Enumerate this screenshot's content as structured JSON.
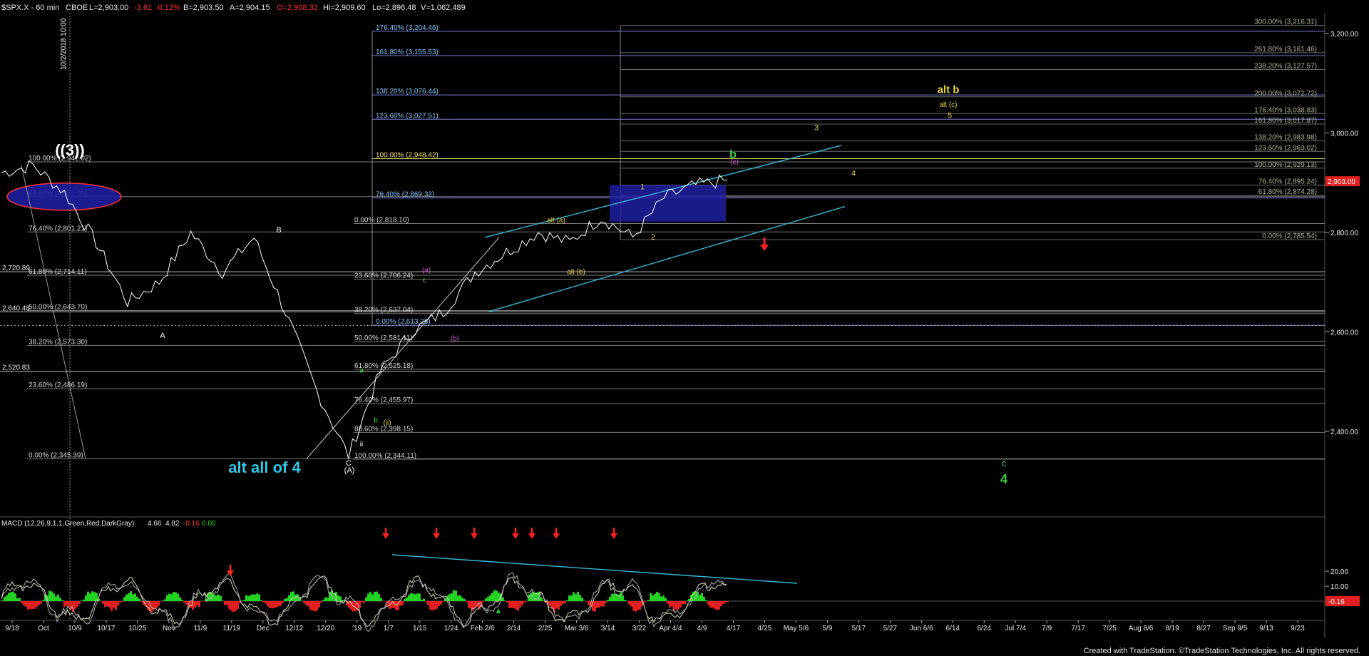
{
  "header": {
    "symbol": "$SPX.X - 60 min",
    "exchange": "CBOE",
    "last": "L=2,903.00",
    "change": "-3.61",
    "change_pct": "-0.12%",
    "bid": "B=2,903.50",
    "ask": "A=2,904.15",
    "open": "O=2,908.32",
    "high": "Hi=2,909.60",
    "low": "Lo=2,896.48",
    "volume": "V=1,062,489"
  },
  "vertical_date_label": "10/2/2018 10:00",
  "price_axis": {
    "ticks": [
      {
        "label": "3,200.00",
        "value": 3200
      },
      {
        "label": "3,000.00",
        "value": 3000
      },
      {
        "label": "2,800.00",
        "value": 2800
      },
      {
        "label": "2,600.00",
        "value": 2600
      },
      {
        "label": "2,400.00",
        "value": 2400
      }
    ],
    "last_price_tag": "2,903.00"
  },
  "time_axis": [
    "9/18",
    "Oct",
    "10/9",
    "10/17",
    "10/25",
    "Nov",
    "11/9",
    "11/19",
    "Dec",
    "12/12",
    "12/20",
    "'19",
    "1/7",
    "1/15",
    "1/24",
    "Feb 2/6",
    "2/14",
    "2/25",
    "Mar 3/6",
    "3/14",
    "3/22",
    "Apr 4/4",
    "4/9",
    "4/17",
    "4/25",
    "May 5/6",
    "5/9",
    "5/17",
    "5/27",
    "Jun 6/6",
    "6/14",
    "6/24",
    "Jul 7/4",
    "7/9",
    "7/17",
    "7/25",
    "Aug 8/6",
    "8/19",
    "8/27",
    "Sep 9/5",
    "9/13",
    "9/23"
  ],
  "fib_labels": {
    "left": [
      {
        "text": "100.00% (2,942.02)",
        "value": 2942
      },
      {
        "text": "88.60% (2,871.95)",
        "value": 2872
      },
      {
        "text": "76.40% (2,801.21)",
        "value": 2801
      },
      {
        "text": "61.80% (2,714.11)",
        "value": 2714
      },
      {
        "text": "50.00% (2,643.70)",
        "value": 2643
      },
      {
        "text": "38.20% (2,573.30)",
        "value": 2573
      },
      {
        "text": "23.60% (2,486.19)",
        "value": 2486
      },
      {
        "text": "0.00% (2,345.39)",
        "value": 2345
      }
    ],
    "left_edge": [
      {
        "text": "2,720.89",
        "value": 2720.89
      },
      {
        "text": "2,640.48",
        "value": 2640.48
      },
      {
        "text": "2,520.83",
        "value": 2520.83
      }
    ],
    "middle_cyan": [
      {
        "text": "176.40% (3,204.46)",
        "value": 3204.46
      },
      {
        "text": "161.80% (3,155.53)",
        "value": 3155.53
      },
      {
        "text": "138.20% (3,076.44)",
        "value": 3076.44
      },
      {
        "text": "123.60% (3,027.51)",
        "value": 3027.51
      },
      {
        "text": "100.00% (2,948.42)",
        "value": 2948.42
      },
      {
        "text": "76.40% (2,869.32)",
        "value": 2869.32
      },
      {
        "text": "0.00% (2,613.28)",
        "value": 2613.28
      }
    ],
    "middle_white": [
      {
        "text": "0.00% (2,818.10)",
        "value": 2818
      },
      {
        "text": "23.60% (2,706.24)",
        "value": 2706
      },
      {
        "text": "38.20% (2,637.04)",
        "value": 2637
      },
      {
        "text": "50.00% (2,581.11)",
        "value": 2581
      },
      {
        "text": "61.80% (2,525.18)",
        "value": 2525
      },
      {
        "text": "76.40% (2,455.97)",
        "value": 2456
      },
      {
        "text": "88.60% (2,398.15)",
        "value": 2398
      },
      {
        "text": "100.00% (2,344.11)",
        "value": 2344
      }
    ],
    "right": [
      {
        "text": "300.00% (3,216.31)",
        "value": 3216.31
      },
      {
        "text": "261.80% (3,161.46)",
        "value": 3161.46
      },
      {
        "text": "238.20% (3,127.57)",
        "value": 3127.57
      },
      {
        "text": "200.00% (3,072.72)",
        "value": 3072.72
      },
      {
        "text": "176.40% (3,038.83)",
        "value": 3038.83
      },
      {
        "text": "161.80% (3,017.87)",
        "value": 3017.87
      },
      {
        "text": "138.20% (2,983.98)",
        "value": 2983.98
      },
      {
        "text": "123.60% (2,963.02)",
        "value": 2963.02
      },
      {
        "text": "100.00% (2,929.13)",
        "value": 2929.13
      },
      {
        "text": "76.40% (2,895.24)",
        "value": 2895.24
      },
      {
        "text": "61.80% (2,874.28)",
        "value": 2874.28
      },
      {
        "text": "0.00% (2,785.54)",
        "value": 2785.54
      }
    ]
  },
  "wave_labels": [
    {
      "text": "((3))",
      "color": "#ffffff"
    },
    {
      "text": "A",
      "color": "#ffffff"
    },
    {
      "text": "B",
      "color": "#ffffff"
    },
    {
      "text": "C",
      "color": "#ffffff"
    },
    {
      "text": "(A)",
      "color": "#ffffff"
    },
    {
      "text": "alt all of 4",
      "color": "#33c5e6"
    },
    {
      "text": "ii",
      "color": "#ffffff"
    },
    {
      "text": "(ii)",
      "color": "#e8d33a"
    },
    {
      "text": "a",
      "color": "#3fd13f"
    },
    {
      "text": "b",
      "color": "#3fd13f"
    },
    {
      "text": "c",
      "color": "#3fd13f"
    },
    {
      "text": "(a)",
      "color": "#d04fd0"
    },
    {
      "text": "(b)",
      "color": "#d04fd0"
    },
    {
      "text": "alt (a)",
      "color": "#e8d33a"
    },
    {
      "text": "alt (b)",
      "color": "#e8d33a"
    },
    {
      "text": "1",
      "color": "#e8d33a"
    },
    {
      "text": "2",
      "color": "#e8d33a"
    },
    {
      "text": "3",
      "color": "#e8d33a"
    },
    {
      "text": "4",
      "color": "#e8d33a"
    },
    {
      "text": "5",
      "color": "#e8d33a"
    },
    {
      "text": "b",
      "color": "#3fd13f"
    },
    {
      "text": "(c)",
      "color": "#d04fd0"
    },
    {
      "text": "alt b",
      "color": "#e8d33a"
    },
    {
      "text": "alt (c)",
      "color": "#e8d33a"
    },
    {
      "text": "c",
      "color": "#3fd13f"
    },
    {
      "text": "4",
      "color": "#3fd13f"
    }
  ],
  "macd": {
    "title": "MACD (12,26,9,1,1,Green,Red,DarkGray)",
    "v1": "4.66",
    "v2": "4.82",
    "v3": "-0.16",
    "v4": "0.00",
    "ticks": [
      {
        "label": "20.00",
        "value": 20
      },
      {
        "label": "10.00",
        "value": 10
      }
    ],
    "tag": "-0.16"
  },
  "footer": "Created with TradeStation. ©TradeStation Technologies, Inc. All rights reserved.",
  "chart_data": {
    "type": "line",
    "title": "$SPX.X - 60 min",
    "xlabel": "",
    "ylabel": "",
    "ylim": [
      2310,
      3250
    ],
    "x_categories": [
      "9/18",
      "Oct",
      "10/9",
      "10/17",
      "10/25",
      "Nov",
      "11/9",
      "11/19",
      "Dec",
      "12/12",
      "12/20",
      "'19",
      "1/7",
      "1/15",
      "1/24",
      "Feb 2/6",
      "2/14",
      "2/25",
      "Mar 3/6",
      "3/14",
      "3/22",
      "Apr 4/4",
      "4/9",
      "4/17"
    ],
    "series": [
      {
        "values": [
          2920,
          2935,
          2880,
          2780,
          2660,
          2700,
          2800,
          2720,
          2790,
          2640,
          2480,
          2351,
          2520,
          2600,
          2640,
          2720,
          2760,
          2800,
          2780,
          2830,
          2790,
          2870,
          2895,
          2905
        ]
      }
    ],
    "macd_ylim": [
      -10,
      30
    ],
    "grid": false,
    "legend": "none"
  },
  "colors": {
    "background": "#000000",
    "price": "#ffffff",
    "fib_line": "#7a7a7a",
    "blue_box": "#1e1ea0",
    "channel": "#35b8d8",
    "arrow": "#ff2020",
    "macd_pos": "#22d322",
    "macd_neg": "#e02020"
  }
}
